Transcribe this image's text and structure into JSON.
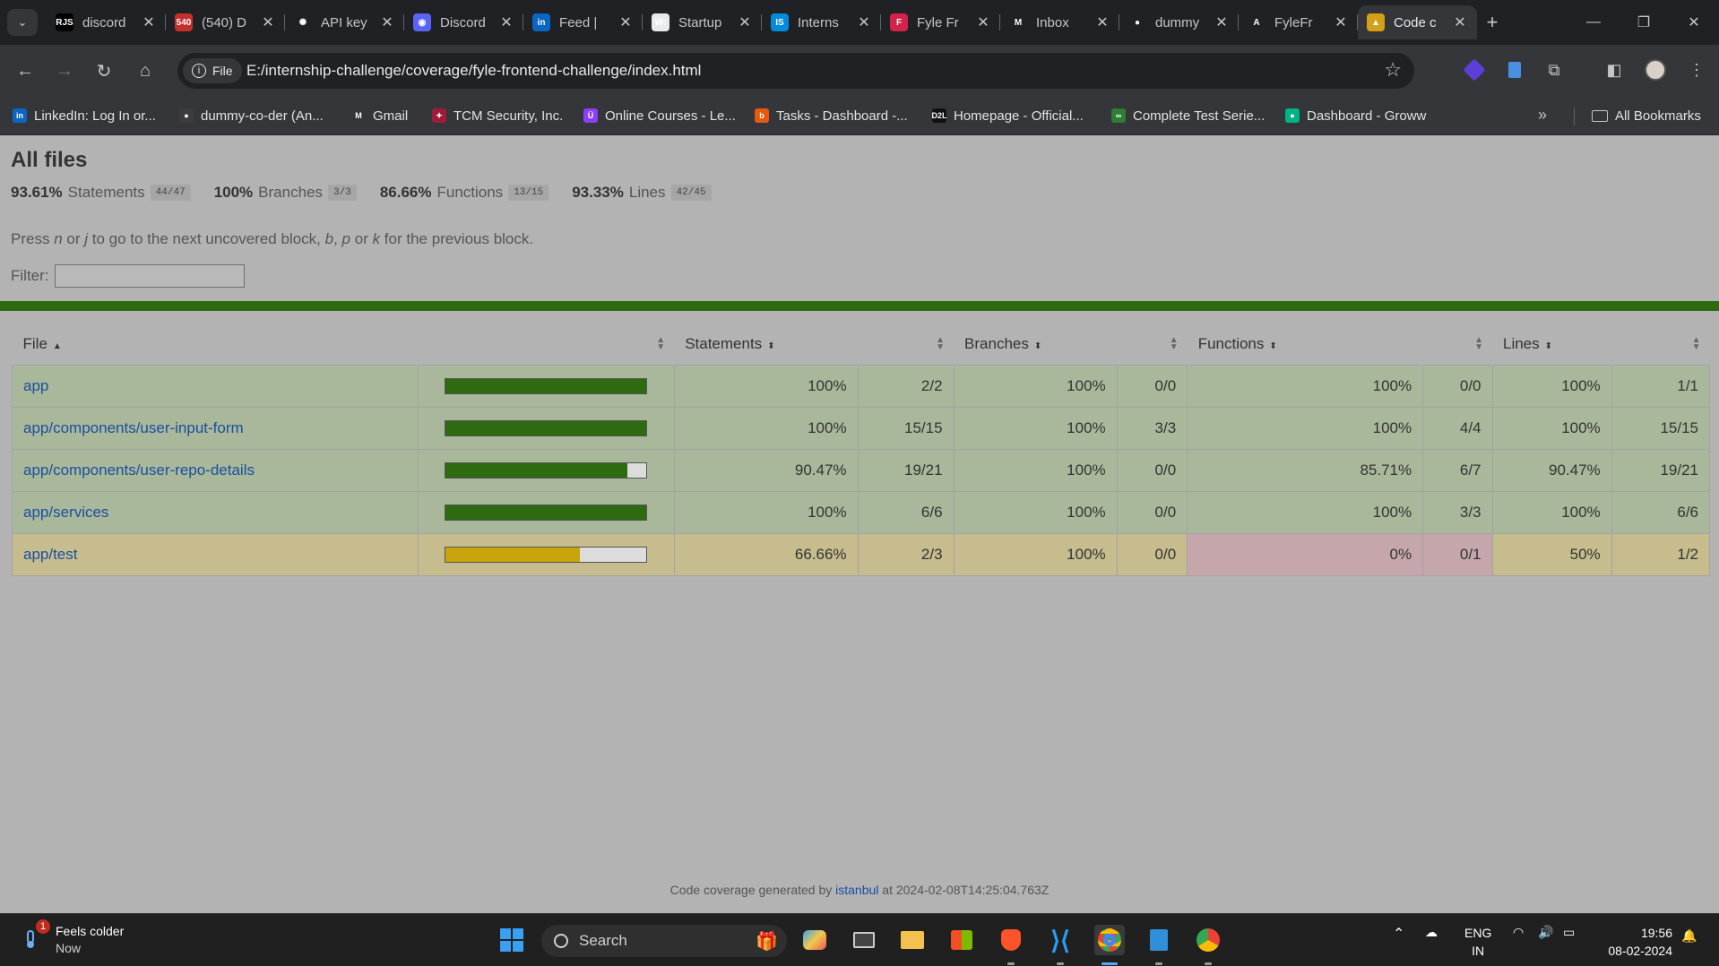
{
  "browser": {
    "tabs": [
      {
        "label": "discord",
        "icon": "rjs-favicon-icon",
        "color": "#000000",
        "glyph": "RJS"
      },
      {
        "label": "(540) D",
        "icon": "youtube-favicon-icon",
        "color": "#c4302b",
        "glyph": "540"
      },
      {
        "label": "API key",
        "icon": "openai-favicon-icon",
        "color": "#202124",
        "glyph": "✺"
      },
      {
        "label": "Discord",
        "icon": "discord-favicon-icon",
        "color": "#5865f2",
        "glyph": "◉"
      },
      {
        "label": "Feed |",
        "icon": "linkedin-favicon-icon",
        "color": "#0a66c2",
        "glyph": "in"
      },
      {
        "label": "Startup",
        "icon": "wellfound-favicon-icon",
        "color": "#e8eaed",
        "glyph": "W:"
      },
      {
        "label": "Interns",
        "icon": "internshala-favicon-icon",
        "color": "#008bdc",
        "glyph": "IS"
      },
      {
        "label": "Fyle Fr",
        "icon": "fyle-favicon-icon",
        "color": "#d3234a",
        "glyph": "F"
      },
      {
        "label": "Inbox",
        "icon": "gmail-favicon-icon",
        "color": "#202124",
        "glyph": "M"
      },
      {
        "label": "dummy",
        "icon": "github-favicon-icon",
        "color": "#202124",
        "glyph": "●"
      },
      {
        "label": "FyleFr",
        "icon": "angular-favicon-icon",
        "color": "#202124",
        "glyph": "A"
      },
      {
        "label": "Code c",
        "icon": "istanbul-favicon-icon",
        "color": "#d4a017",
        "glyph": "▲",
        "active": true
      }
    ],
    "file_chip": "File",
    "url": "E:/internship-challenge/coverage/fyle-frontend-challenge/index.html",
    "bookmarks": [
      {
        "label": "LinkedIn: Log In or...",
        "icon": "linkedin-icon",
        "color": "#0a66c2",
        "glyph": "in"
      },
      {
        "label": "dummy-co-der (An...",
        "icon": "github-icon",
        "color": "#3c3c3c",
        "glyph": "●"
      },
      {
        "label": "Gmail",
        "icon": "gmail-icon",
        "color": "#35363a",
        "glyph": "M"
      },
      {
        "label": "TCM Security, Inc.",
        "icon": "tcm-security-icon",
        "color": "#a01a3a",
        "glyph": "✦"
      },
      {
        "label": "Online Courses - Le...",
        "icon": "udemy-icon",
        "color": "#8a3ffc",
        "glyph": "Ü"
      },
      {
        "label": "Tasks - Dashboard -...",
        "icon": "tasks-dashboard-icon",
        "color": "#e8590c",
        "glyph": "b"
      },
      {
        "label": "Homepage - Official...",
        "icon": "d2l-icon",
        "color": "#111111",
        "glyph": "D2L"
      },
      {
        "label": "Complete Test Serie...",
        "icon": "test-series-icon",
        "color": "#2e7d32",
        "glyph": "∞"
      },
      {
        "label": "Dashboard - Groww",
        "icon": "groww-icon",
        "color": "#00b386",
        "glyph": "●"
      }
    ],
    "all_bookmarks": "All Bookmarks"
  },
  "report": {
    "title": "All files",
    "summary": [
      {
        "pct": "93.61%",
        "label": "Statements",
        "fraction": "44/47"
      },
      {
        "pct": "100%",
        "label": "Branches",
        "fraction": "3/3"
      },
      {
        "pct": "86.66%",
        "label": "Functions",
        "fraction": "13/15"
      },
      {
        "pct": "93.33%",
        "label": "Lines",
        "fraction": "42/45"
      }
    ],
    "hint": {
      "p1": "Press ",
      "k1": "n",
      "p2": " or ",
      "k2": "j",
      "p3": " to go to the next uncovered block, ",
      "k3": "b",
      "p4": ", ",
      "k4": "p",
      "p5": " or ",
      "k5": "k",
      "p6": " for the previous block."
    },
    "filter_label": "Filter:",
    "headers": {
      "file": "File",
      "statements": "Statements",
      "branches": "Branches",
      "functions": "Functions",
      "lines": "Lines"
    },
    "rows": [
      {
        "file": "app",
        "bar_pct": 100,
        "level": "high",
        "statements": "100%",
        "statements_frac": "2/2",
        "branches": "100%",
        "branches_frac": "0/0",
        "functions": "100%",
        "functions_frac": "0/0",
        "lines": "100%",
        "lines_frac": "1/1"
      },
      {
        "file": "app/components/user-input-form",
        "bar_pct": 100,
        "level": "high",
        "statements": "100%",
        "statements_frac": "15/15",
        "branches": "100%",
        "branches_frac": "3/3",
        "functions": "100%",
        "functions_frac": "4/4",
        "lines": "100%",
        "lines_frac": "15/15"
      },
      {
        "file": "app/components/user-repo-details",
        "bar_pct": 90.47,
        "level": "high",
        "statements": "90.47%",
        "statements_frac": "19/21",
        "branches": "100%",
        "branches_frac": "0/0",
        "functions": "85.71%",
        "functions_frac": "6/7",
        "lines": "90.47%",
        "lines_frac": "19/21"
      },
      {
        "file": "app/services",
        "bar_pct": 100,
        "level": "high",
        "statements": "100%",
        "statements_frac": "6/6",
        "branches": "100%",
        "branches_frac": "0/0",
        "functions": "100%",
        "functions_frac": "3/3",
        "lines": "100%",
        "lines_frac": "6/6"
      },
      {
        "file": "app/test",
        "bar_pct": 66.66,
        "level": "medium",
        "statements": "66.66%",
        "statements_frac": "2/3",
        "branches": "100%",
        "branches_frac": "0/0",
        "functions": "0%",
        "functions_frac": "0/1",
        "functions_low": true,
        "lines": "50%",
        "lines_frac": "1/2"
      }
    ],
    "footer_prefix": "Code coverage generated by ",
    "footer_link": "istanbul",
    "footer_suffix": " at 2024-02-08T14:25:04.763Z",
    "colors": {
      "high_bar": "#2d6a10",
      "medium_bar": "#c8a40d",
      "high_row": "#a9b89a",
      "medium_row": "#c6bc8e",
      "low_cell": "#c4a6ab"
    }
  },
  "taskbar": {
    "weather_title": "Feels colder",
    "weather_sub": "Now",
    "weather_badge": "1",
    "search_placeholder": "Search",
    "lang_top": "ENG",
    "lang_bottom": "IN",
    "time": "19:56",
    "date": "08-02-2024"
  }
}
